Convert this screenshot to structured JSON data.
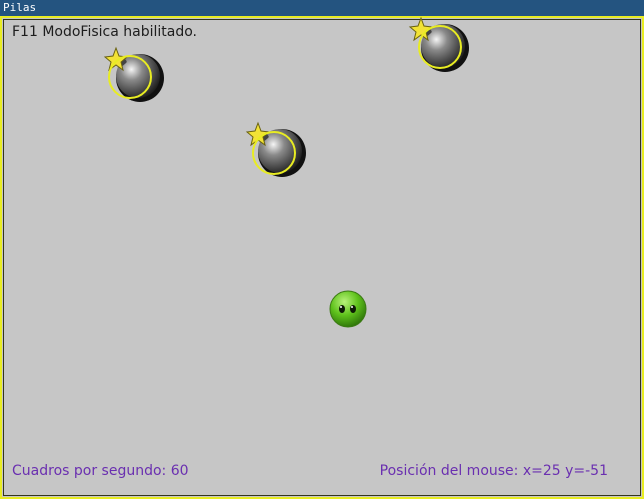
{
  "window": {
    "title": "Pilas"
  },
  "hud": {
    "mode_message": "F11 ModoFisica habilitado.",
    "fps_text": "Cuadros por segundo: 60",
    "mouse_text": "Posición del mouse: x=25 y=-51"
  },
  "scene": {
    "actors": [
      {
        "type": "bomb",
        "icon": "bomb-icon"
      },
      {
        "type": "bomb",
        "icon": "bomb-icon"
      },
      {
        "type": "bomb",
        "icon": "bomb-icon"
      },
      {
        "type": "ball",
        "icon": "green-ball-icon"
      }
    ]
  },
  "colors": {
    "titlebar": "#245480",
    "background": "#c6c6c6",
    "frame": "#e8ec22",
    "hud_text": "#6a2fb0",
    "physics_outline": "#e8ec22"
  }
}
